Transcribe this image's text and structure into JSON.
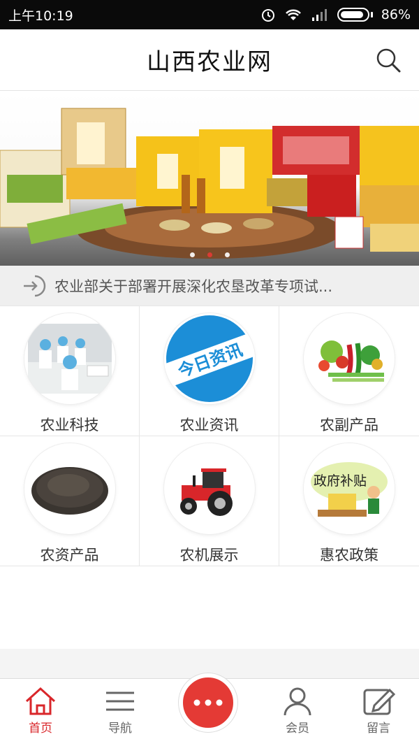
{
  "status_bar": {
    "time": "上午10:19",
    "battery": "86%"
  },
  "header": {
    "title": "山西农业网"
  },
  "banner": {
    "slide_count": 3,
    "active_index": 1
  },
  "notice": {
    "text": "农业部关于部署开展深化农垦改革专项试..."
  },
  "categories": [
    {
      "label": "农业科技",
      "icon": "lab-workers-image"
    },
    {
      "label": "农业资讯",
      "icon": "today-news-badge"
    },
    {
      "label": "农副产品",
      "icon": "vegetables-image"
    },
    {
      "label": "农资产品",
      "icon": "seeds-image"
    },
    {
      "label": "农机展示",
      "icon": "tractor-image"
    },
    {
      "label": "惠农政策",
      "icon": "government-subsidy-image"
    }
  ],
  "badge_texts": {
    "news": "今日资讯",
    "policy": "政府补贴"
  },
  "bottom_nav": {
    "home": "首页",
    "nav": "导航",
    "member": "会员",
    "message": "留言"
  },
  "colors": {
    "accent": "#e43a35",
    "active_tab": "#d9262a",
    "news_badge": "#1c8ed7"
  }
}
